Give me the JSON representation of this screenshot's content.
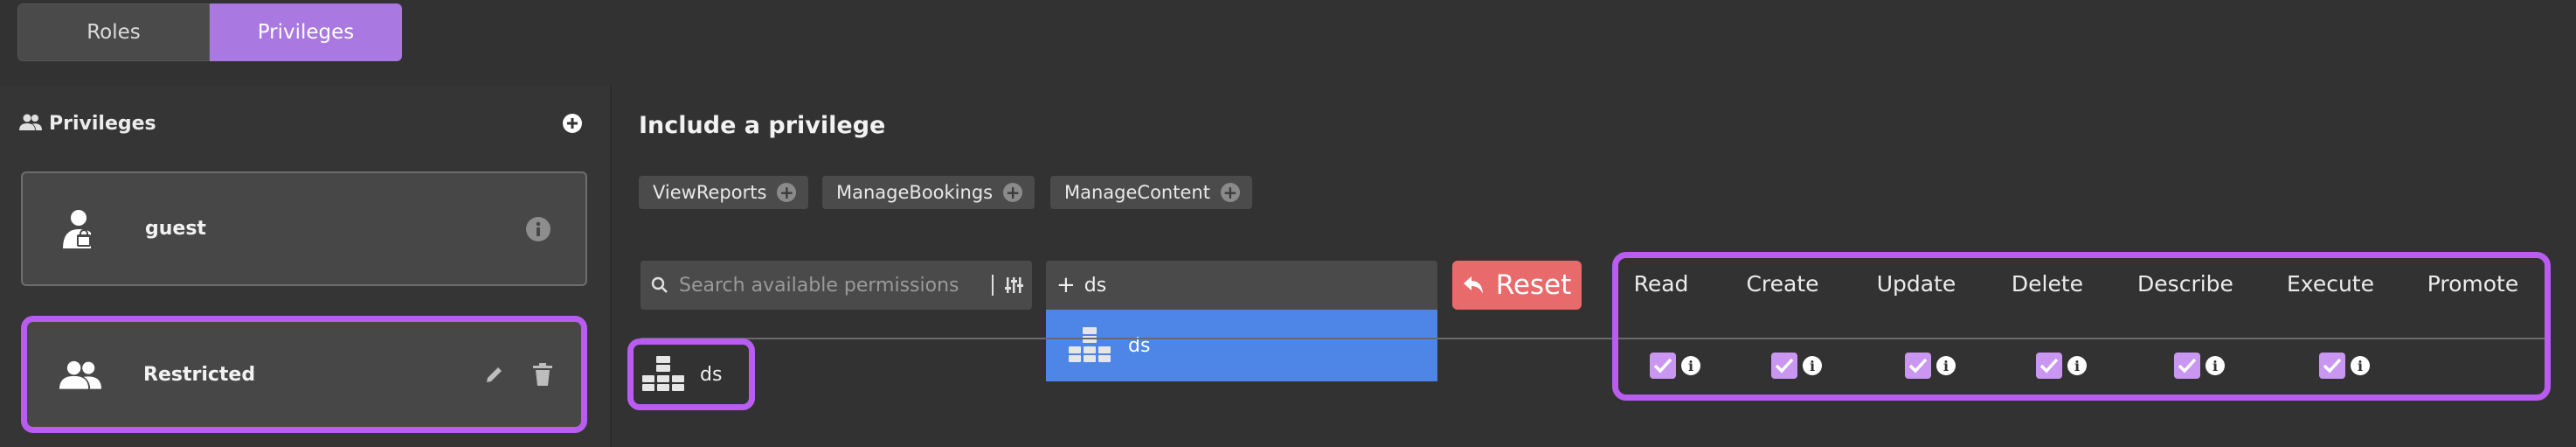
{
  "tabs": [
    {
      "label": "Roles",
      "active": false
    },
    {
      "label": "Privileges",
      "active": true
    }
  ],
  "sidebar": {
    "title": "Privileges",
    "title_icon": "people-icon",
    "add_icon": "plus-circle-icon",
    "roles": [
      {
        "name": "guest",
        "icon": "person-lock-icon",
        "action_icons": [
          "info-icon"
        ]
      },
      {
        "name": "Restricted",
        "icon": "people-icon",
        "action_icons": [
          "pencil-icon",
          "trash-icon"
        ],
        "selected": true
      }
    ]
  },
  "main": {
    "heading": "Include a privilege",
    "available_chips": [
      {
        "label": "ViewReports",
        "icon": "plus-circle-icon"
      },
      {
        "label": "ManageBookings",
        "icon": "plus-circle-icon"
      },
      {
        "label": "ManageContent",
        "icon": "plus-circle-icon"
      }
    ],
    "search": {
      "placeholder": "Search available permissions",
      "icon": "search-icon",
      "filter_icon": "sliders-icon"
    },
    "combo": {
      "prefix": "+",
      "value": "ds"
    },
    "dropdown": {
      "option_label": "ds",
      "icon": "database-icon",
      "highlight_color": "#4d86e6"
    },
    "reset_label": "Reset",
    "reset_icon": "undo-arrow-icon",
    "selected_node": {
      "label": "ds",
      "icon": "database-icon"
    },
    "permissions": {
      "columns": [
        "Read",
        "Create",
        "Update",
        "Delete",
        "Describe",
        "Execute",
        "Promote"
      ],
      "checked": [
        true,
        true,
        true,
        true,
        true,
        true,
        false
      ],
      "info_icon_label": "i"
    }
  },
  "colors": {
    "accent": "#a978e0",
    "highlight_border": "#b95cf0",
    "reset": "#e86a6a",
    "background": "#323232"
  }
}
